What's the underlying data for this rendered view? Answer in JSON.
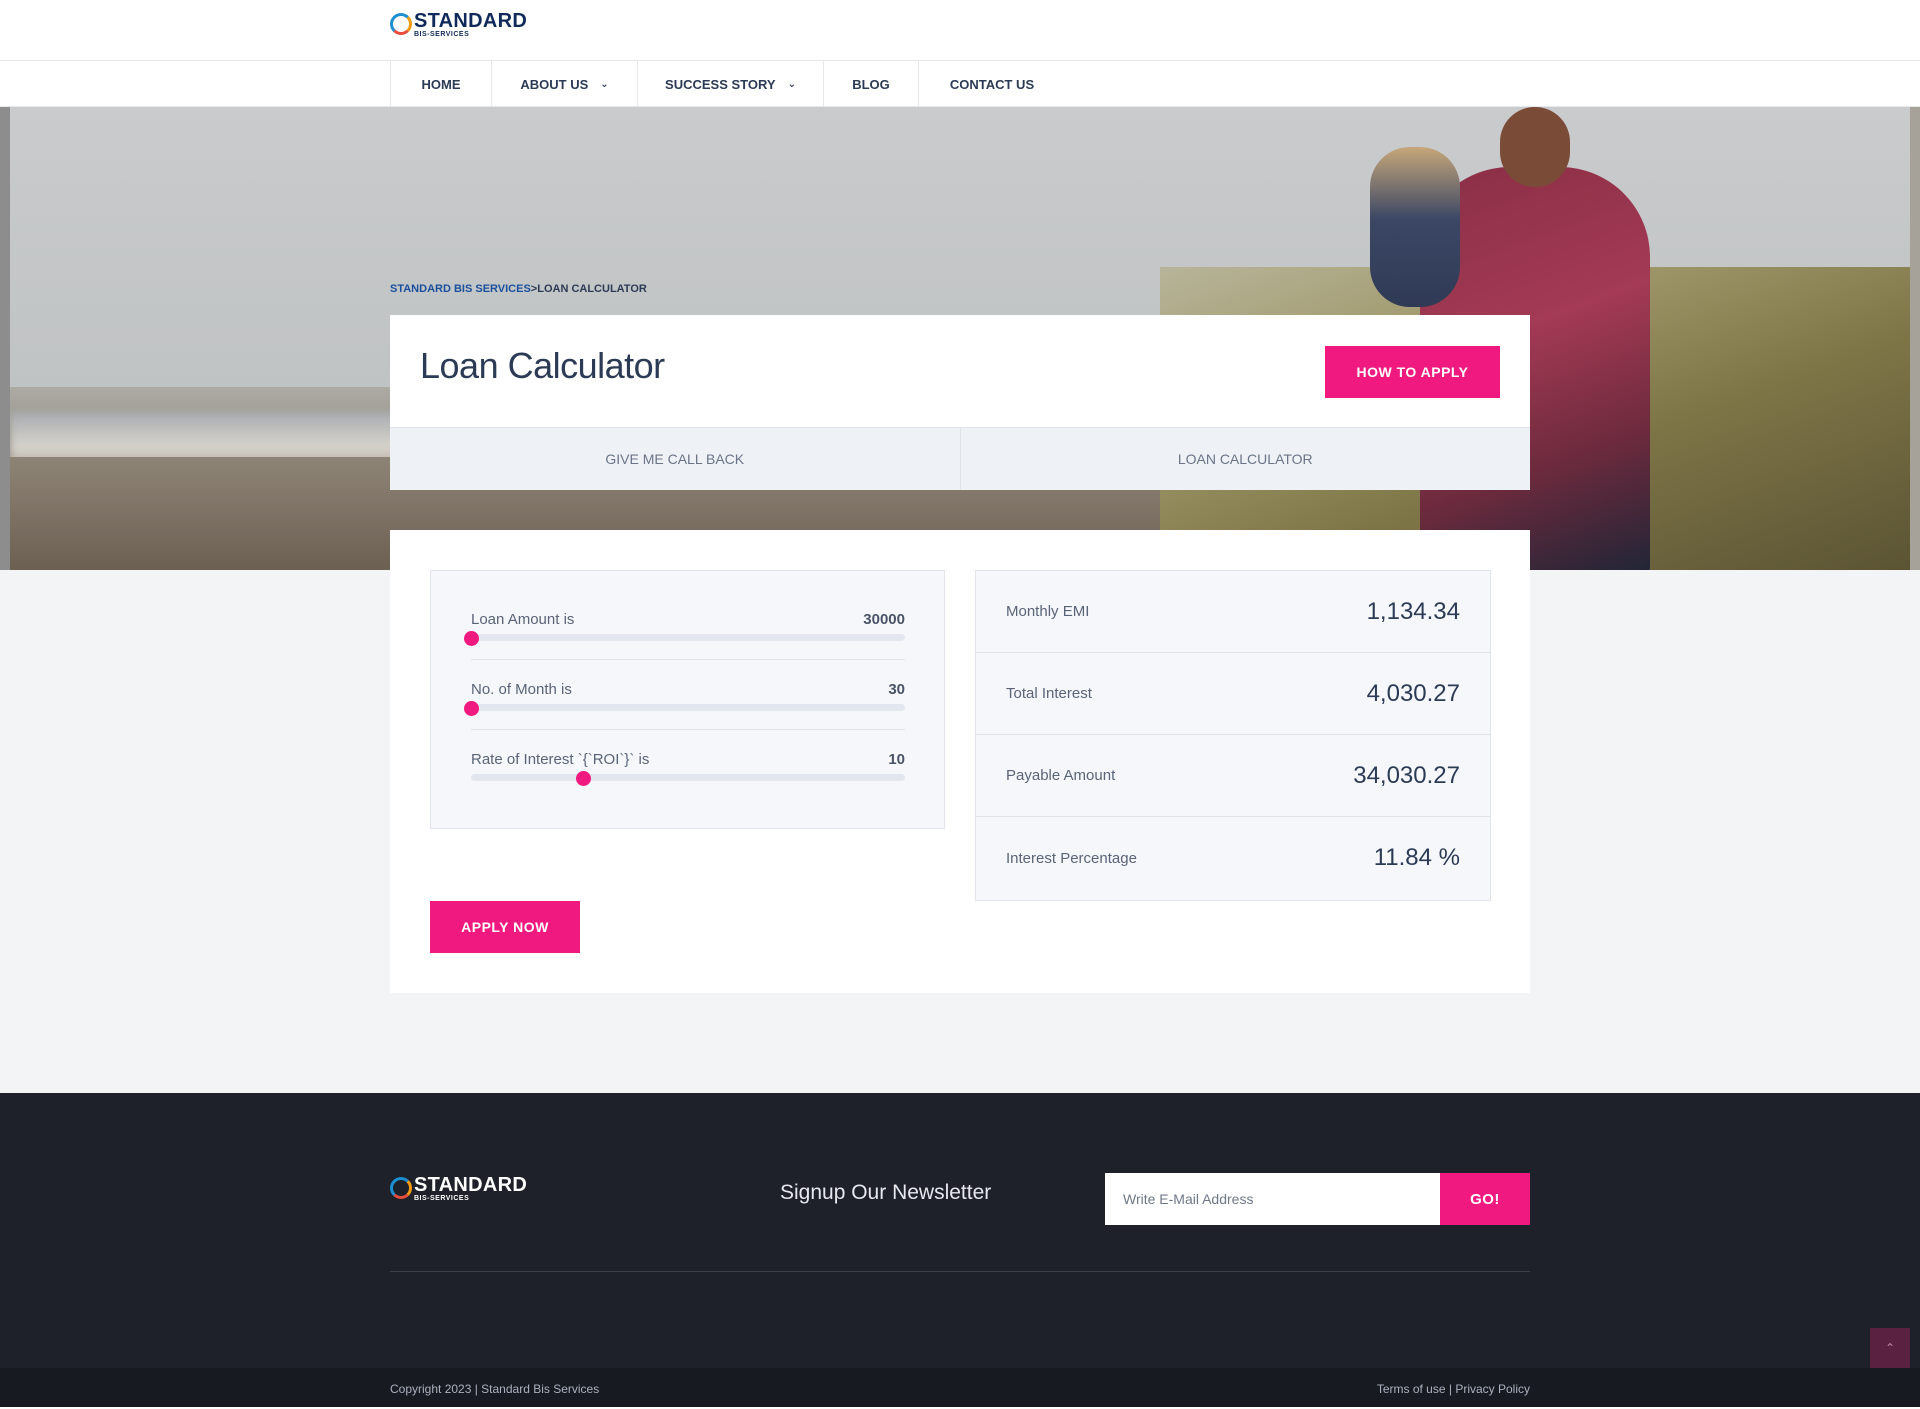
{
  "brand": {
    "logo_main": "STANDARD",
    "logo_sub": "BIS-SERVICES"
  },
  "nav": {
    "items": [
      {
        "label": "HOME",
        "dropdown": false
      },
      {
        "label": "ABOUT US",
        "dropdown": true
      },
      {
        "label": "SUCCESS STORY",
        "dropdown": true
      },
      {
        "label": "BLOG",
        "dropdown": false
      },
      {
        "label": "CONTACT US",
        "dropdown": false
      }
    ]
  },
  "breadcrumb": {
    "link": "STANDARD BIS SERVICES",
    "separator": ">",
    "current": "LOAN CALCULATOR"
  },
  "page": {
    "title": "Loan Calculator",
    "how_to_apply": "HOW TO APPLY"
  },
  "tabs": [
    {
      "label": "GIVE ME CALL BACK"
    },
    {
      "label": "LOAN CALCULATOR"
    }
  ],
  "calculator": {
    "sliders": [
      {
        "label": "Loan Amount is",
        "value": "30000",
        "position": 0.0
      },
      {
        "label": "No. of Month is",
        "value": "30",
        "position": 0.0
      },
      {
        "label": "Rate of Interest `{`ROI`}` is",
        "value": "10",
        "position": 0.257
      }
    ],
    "results": [
      {
        "label": "Monthly EMI",
        "value": "1,134.34"
      },
      {
        "label": "Total Interest",
        "value": "4,030.27"
      },
      {
        "label": "Payable Amount",
        "value": "34,030.27"
      },
      {
        "label": "Interest Percentage",
        "value": "11.84 %"
      }
    ],
    "apply_now": "APPLY NOW"
  },
  "footer": {
    "newsletter_title": "Signup Our Newsletter",
    "email_placeholder": "Write E-Mail Address",
    "go_label": "GO!",
    "copyright": "Copyright 2023 | Standard Bis Services",
    "terms": "Terms of use",
    "legal_separator": " | ",
    "privacy": "Privacy Policy",
    "scroll_top_icon": "chevron-up-icon"
  },
  "colors": {
    "accent": "#f0197f",
    "navy": "#2b3a55",
    "footer_bg": "#1e212a"
  }
}
